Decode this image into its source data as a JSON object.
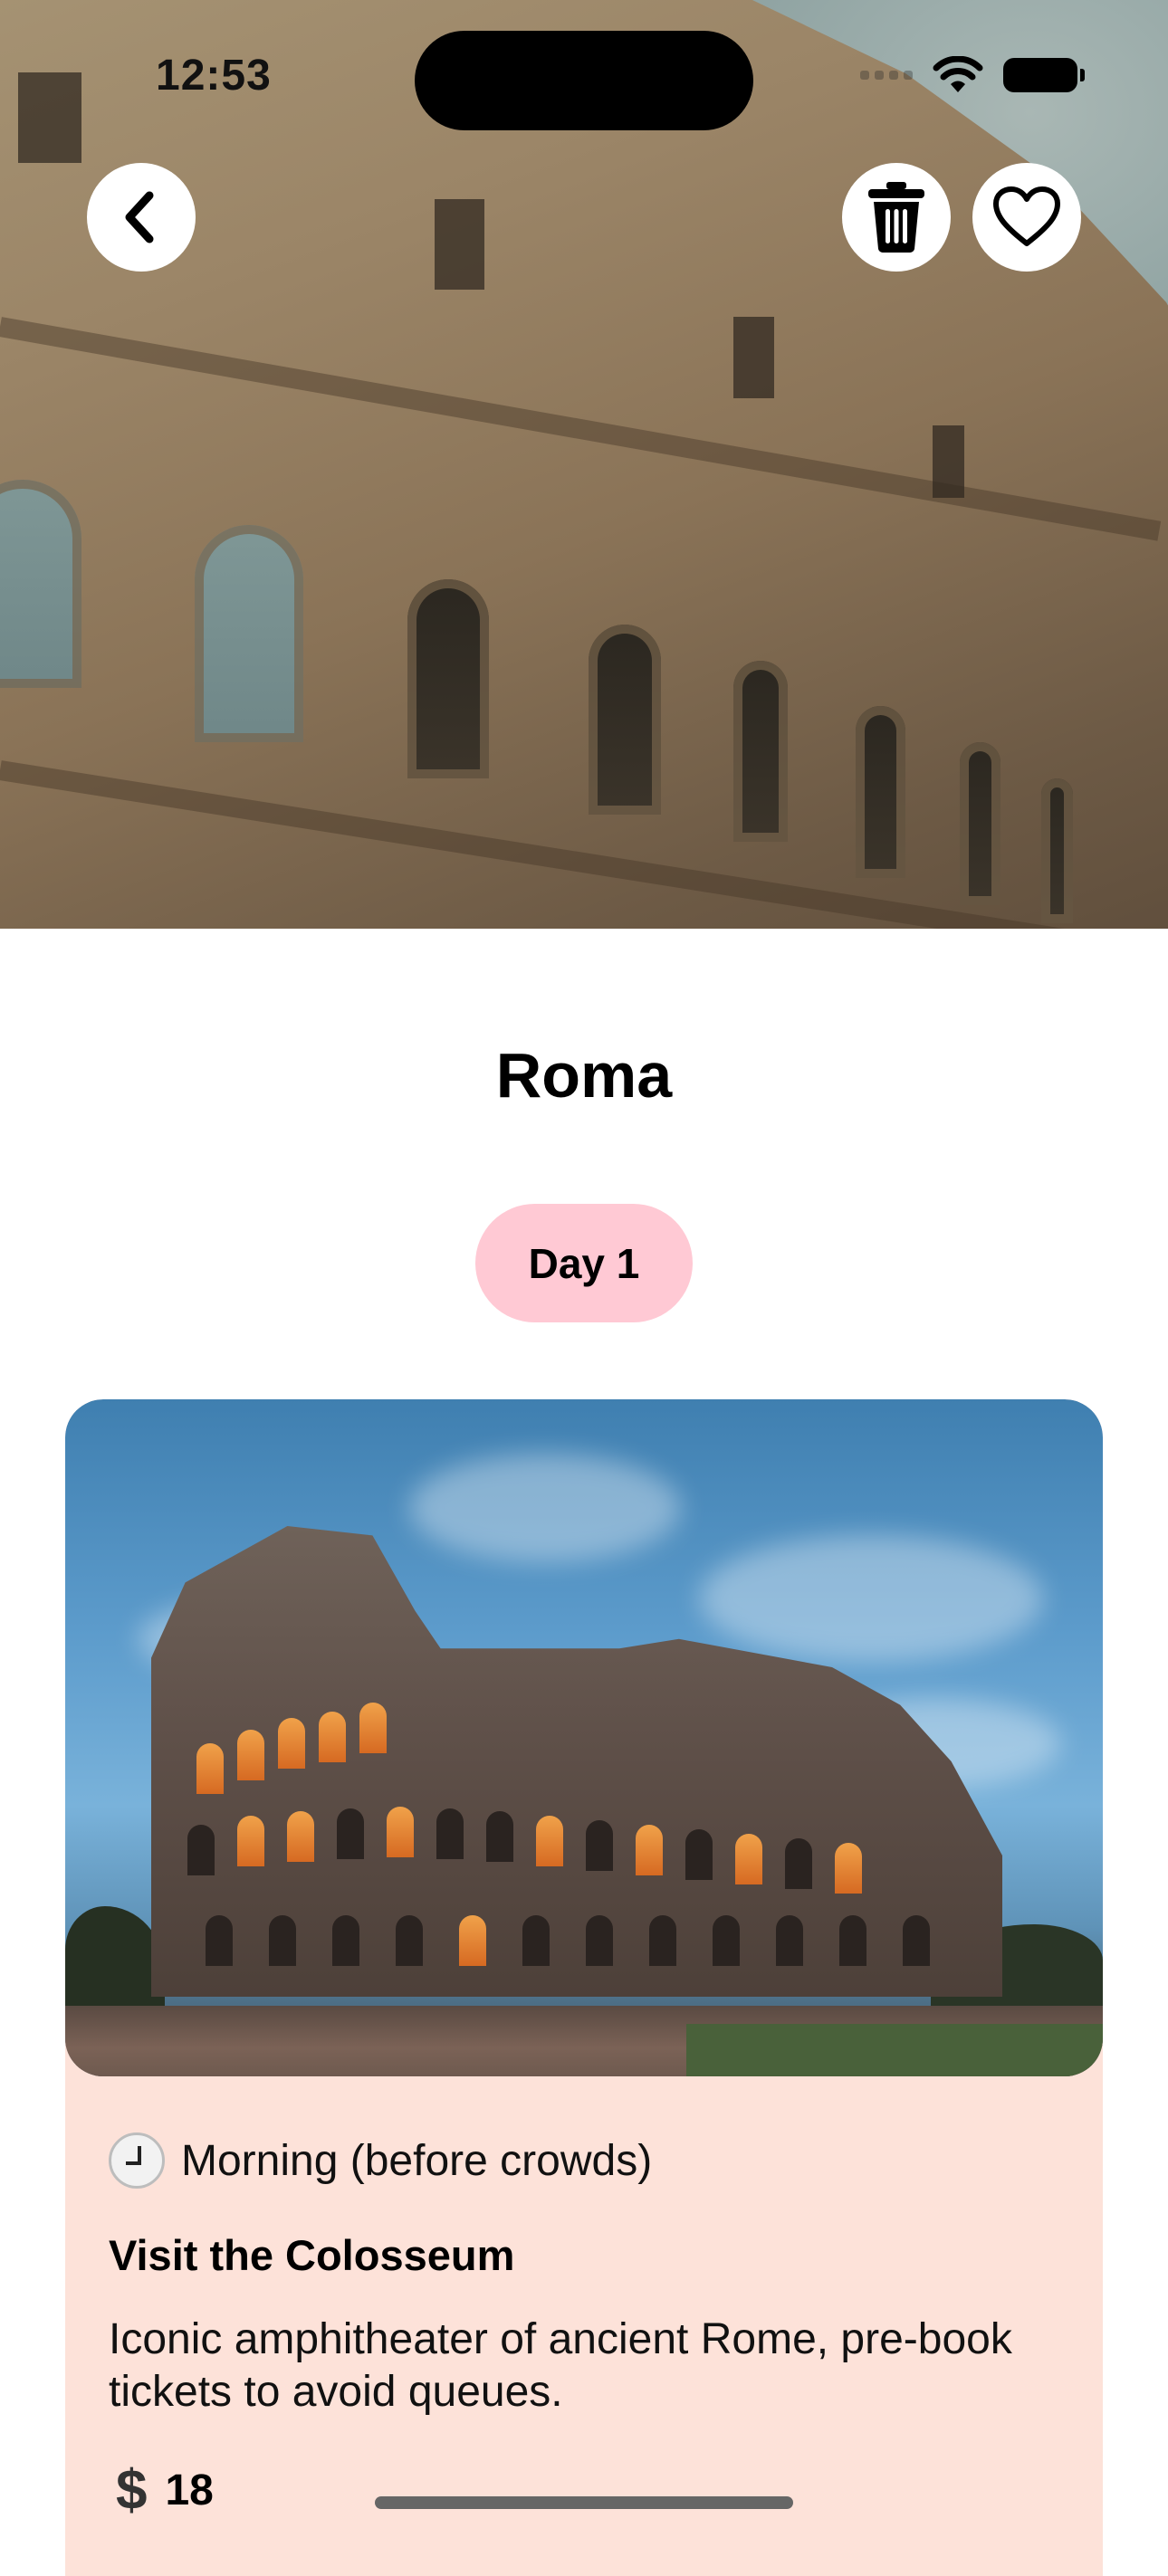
{
  "status_bar": {
    "time": "12:53"
  },
  "header": {
    "back_icon": "chevron-left-icon",
    "delete_icon": "trash-icon",
    "favorite_icon": "heart-outline-icon"
  },
  "trip": {
    "city": "Roma",
    "day_label": "Day 1"
  },
  "activity": {
    "time_icon": "clock-emoji-icon",
    "time_of_day": "Morning (before crowds)",
    "title": "Visit the Colosseum",
    "description": "Iconic amphitheater of ancient Rome, pre-book tickets to avoid queues.",
    "currency_icon": "dollar-icon",
    "currency_symbol": "$",
    "price": "18"
  },
  "colors": {
    "day_pill": "#ffc9d4",
    "card_background": "#fde2d9"
  }
}
